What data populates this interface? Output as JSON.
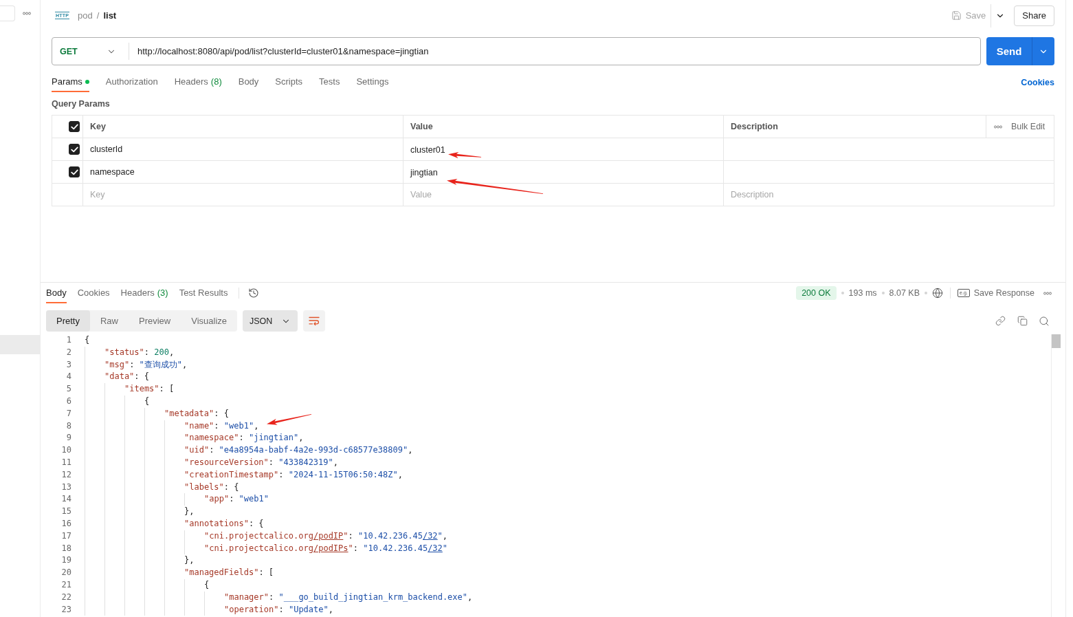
{
  "header": {
    "type_label": "HTTP",
    "breadcrumb": [
      {
        "label": "pod",
        "current": false
      },
      {
        "label": "list",
        "current": true
      }
    ],
    "separator": "/",
    "save": {
      "label": "Save",
      "disabled": true
    },
    "share": "Share"
  },
  "request": {
    "method": "GET",
    "url": "http://localhost:8080/api/pod/list?clusterId=cluster01&namespace=jingtian",
    "send": "Send"
  },
  "request_tabs": [
    {
      "label": "Params",
      "selected": true,
      "dot": true
    },
    {
      "label": "Authorization",
      "selected": false,
      "dot": false
    },
    {
      "label": "Headers",
      "count": "(8)",
      "selected": false,
      "dot": false
    },
    {
      "label": "Body",
      "selected": false,
      "dot": false
    },
    {
      "label": "Scripts",
      "selected": false,
      "dot": false
    },
    {
      "label": "Tests",
      "selected": false,
      "dot": false
    },
    {
      "label": "Settings",
      "selected": false,
      "dot": false
    }
  ],
  "cookies": "Cookies",
  "query_params": {
    "title": "Query Params",
    "all_checked": true,
    "columns": [
      "Key",
      "Value",
      "Description"
    ],
    "bulk_edit": "Bulk Edit",
    "rows": [
      {
        "checked": true,
        "key": "clusterId",
        "value": "cluster01",
        "marked": true
      },
      {
        "checked": true,
        "key": "namespace",
        "value": "jingtian",
        "marked": true
      }
    ],
    "new_row": [
      {
        "placeholder": "Key"
      },
      {
        "placeholder": "Value"
      },
      {
        "placeholder": "Description"
      }
    ]
  },
  "response": {
    "tabs": [
      {
        "label": "Body",
        "selected": true
      },
      {
        "label": "Cookies",
        "selected": false
      },
      {
        "label": "Headers",
        "count": "(3)",
        "selected": false
      },
      {
        "label": "Test Results",
        "selected": false
      }
    ],
    "status": "200 OK",
    "time": "193 ms",
    "size": "8.07 KB",
    "save_icon_text": "e.g.",
    "save_label": "Save Response",
    "views": [
      {
        "label": "Pretty",
        "selected": true
      },
      {
        "label": "Raw",
        "selected": false
      },
      {
        "label": "Preview",
        "selected": false
      },
      {
        "label": "Visualize",
        "selected": false
      }
    ],
    "format": "JSON",
    "wrap": true,
    "body_lines": [
      {
        "number": "1",
        "tokens": [
          {
            "kind": "punct",
            "text": "{"
          }
        ],
        "children": [
          {
            "number": "2",
            "tokens": [
              {
                "kind": "key",
                "text": "\"status\""
              },
              {
                "kind": "punct",
                "text": ": "
              },
              {
                "kind": "number",
                "text": "200"
              },
              {
                "kind": "punct",
                "text": ","
              }
            ]
          },
          {
            "number": "3",
            "tokens": [
              {
                "kind": "key",
                "text": "\"msg\""
              },
              {
                "kind": "punct",
                "text": ": "
              },
              {
                "kind": "string",
                "text": "\"查询成功\""
              },
              {
                "kind": "punct",
                "text": ","
              }
            ]
          },
          {
            "number": "4",
            "tokens": [
              {
                "kind": "key",
                "text": "\"data\""
              },
              {
                "kind": "punct",
                "text": ": {"
              }
            ],
            "children": [
              {
                "number": "5",
                "tokens": [
                  {
                    "kind": "key",
                    "text": "\"items\""
                  },
                  {
                    "kind": "punct",
                    "text": ": ["
                  }
                ],
                "children": [
                  {
                    "number": "6",
                    "tokens": [
                      {
                        "kind": "punct",
                        "text": "{"
                      }
                    ],
                    "children": [
                      {
                        "number": "7",
                        "tokens": [
                          {
                            "kind": "key",
                            "text": "\"metadata\""
                          },
                          {
                            "kind": "punct",
                            "text": ": {"
                          }
                        ],
                        "children": [
                          {
                            "number": "8",
                            "marked": true,
                            "tokens": [
                              {
                                "kind": "key",
                                "text": "\"name\""
                              },
                              {
                                "kind": "punct",
                                "text": ": "
                              },
                              {
                                "kind": "string",
                                "text": "\"web1\""
                              },
                              {
                                "kind": "punct",
                                "text": ","
                              }
                            ]
                          },
                          {
                            "number": "9",
                            "tokens": [
                              {
                                "kind": "key",
                                "text": "\"namespace\""
                              },
                              {
                                "kind": "punct",
                                "text": ": "
                              },
                              {
                                "kind": "string",
                                "text": "\"jingtian\""
                              },
                              {
                                "kind": "punct",
                                "text": ","
                              }
                            ]
                          },
                          {
                            "number": "10",
                            "tokens": [
                              {
                                "kind": "key",
                                "text": "\"uid\""
                              },
                              {
                                "kind": "punct",
                                "text": ": "
                              },
                              {
                                "kind": "string",
                                "text": "\"e4a8954a-babf-4a2e-993d-c68577e38809\""
                              },
                              {
                                "kind": "punct",
                                "text": ","
                              }
                            ]
                          },
                          {
                            "number": "11",
                            "tokens": [
                              {
                                "kind": "key",
                                "text": "\"resourceVersion\""
                              },
                              {
                                "kind": "punct",
                                "text": ": "
                              },
                              {
                                "kind": "string",
                                "text": "\"433842319\""
                              },
                              {
                                "kind": "punct",
                                "text": ","
                              }
                            ]
                          },
                          {
                            "number": "12",
                            "tokens": [
                              {
                                "kind": "key",
                                "text": "\"creationTimestamp\""
                              },
                              {
                                "kind": "punct",
                                "text": ": "
                              },
                              {
                                "kind": "string",
                                "text": "\"2024-11-15T06:50:48Z\""
                              },
                              {
                                "kind": "punct",
                                "text": ","
                              }
                            ]
                          },
                          {
                            "number": "13",
                            "tokens": [
                              {
                                "kind": "key",
                                "text": "\"labels\""
                              },
                              {
                                "kind": "punct",
                                "text": ": {"
                              }
                            ],
                            "children": [
                              {
                                "number": "14",
                                "tokens": [
                                  {
                                    "kind": "key",
                                    "text": "\"app\""
                                  },
                                  {
                                    "kind": "punct",
                                    "text": ": "
                                  },
                                  {
                                    "kind": "string",
                                    "text": "\"web1\""
                                  }
                                ]
                              }
                            ]
                          },
                          {
                            "number": "15",
                            "tokens": [
                              {
                                "kind": "punct",
                                "text": "},"
                              }
                            ]
                          },
                          {
                            "number": "16",
                            "tokens": [
                              {
                                "kind": "key",
                                "text": "\"annotations\""
                              },
                              {
                                "kind": "punct",
                                "text": ": {"
                              }
                            ],
                            "children": [
                              {
                                "number": "17",
                                "tokens": [
                                  {
                                    "kind": "key",
                                    "text": "\"cni.projectcalico.org"
                                  },
                                  {
                                    "kind": "keylink",
                                    "text": "/podIP"
                                  },
                                  {
                                    "kind": "key",
                                    "text": "\""
                                  },
                                  {
                                    "kind": "punct",
                                    "text": ": "
                                  },
                                  {
                                    "kind": "string",
                                    "text": "\"10.42.236.45"
                                  },
                                  {
                                    "kind": "stringlink",
                                    "text": "/32"
                                  },
                                  {
                                    "kind": "string",
                                    "text": "\""
                                  },
                                  {
                                    "kind": "punct",
                                    "text": ","
                                  }
                                ]
                              },
                              {
                                "number": "18",
                                "tokens": [
                                  {
                                    "kind": "key",
                                    "text": "\"cni.projectcalico.org"
                                  },
                                  {
                                    "kind": "keylink",
                                    "text": "/podIPs"
                                  },
                                  {
                                    "kind": "key",
                                    "text": "\""
                                  },
                                  {
                                    "kind": "punct",
                                    "text": ": "
                                  },
                                  {
                                    "kind": "string",
                                    "text": "\"10.42.236.45"
                                  },
                                  {
                                    "kind": "stringlink",
                                    "text": "/32"
                                  },
                                  {
                                    "kind": "string",
                                    "text": "\""
                                  }
                                ]
                              }
                            ]
                          },
                          {
                            "number": "19",
                            "tokens": [
                              {
                                "kind": "punct",
                                "text": "},"
                              }
                            ]
                          },
                          {
                            "number": "20",
                            "tokens": [
                              {
                                "kind": "key",
                                "text": "\"managedFields\""
                              },
                              {
                                "kind": "punct",
                                "text": ": ["
                              }
                            ],
                            "children": [
                              {
                                "number": "21",
                                "tokens": [
                                  {
                                    "kind": "punct",
                                    "text": "{"
                                  }
                                ],
                                "children": [
                                  {
                                    "number": "22",
                                    "tokens": [
                                      {
                                        "kind": "key",
                                        "text": "\"manager\""
                                      },
                                      {
                                        "kind": "punct",
                                        "text": ": "
                                      },
                                      {
                                        "kind": "string",
                                        "text": "\"___go_build_jingtian_krm_backend.exe\""
                                      },
                                      {
                                        "kind": "punct",
                                        "text": ","
                                      }
                                    ]
                                  },
                                  {
                                    "number": "23",
                                    "tokens": [
                                      {
                                        "kind": "key",
                                        "text": "\"operation\""
                                      },
                                      {
                                        "kind": "punct",
                                        "text": ": "
                                      },
                                      {
                                        "kind": "string",
                                        "text": "\"Update\""
                                      },
                                      {
                                        "kind": "punct",
                                        "text": ","
                                      }
                                    ]
                                  }
                                ]
                              }
                            ]
                          }
                        ]
                      }
                    ]
                  }
                ]
              }
            ]
          }
        ]
      }
    ]
  }
}
